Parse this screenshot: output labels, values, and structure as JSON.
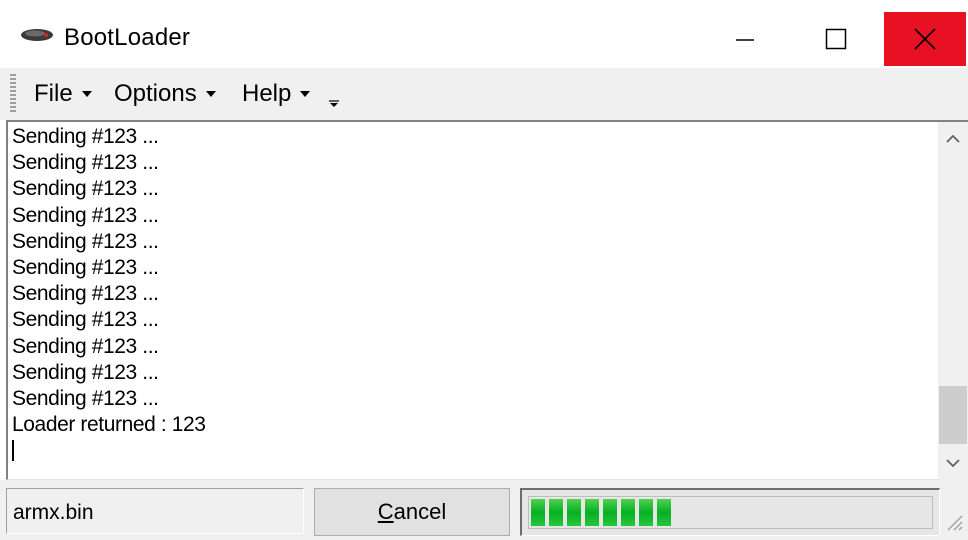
{
  "window": {
    "title": "BootLoader",
    "icons": {
      "app": "device-icon",
      "minimize": "minimize-icon",
      "maximize": "maximize-icon",
      "close": "close-icon"
    },
    "close_color": "#e81123"
  },
  "menubar": {
    "items": [
      {
        "label": "File"
      },
      {
        "label": "Options"
      },
      {
        "label": "Help"
      }
    ],
    "overflow_icon": "chevron-down-icon"
  },
  "log": {
    "lines": [
      "Sending #123 ...",
      "Sending #123 ...",
      "Sending #123 ...",
      "Sending #123 ...",
      "Sending #123 ...",
      "Sending #123 ...",
      "Sending #123 ...",
      "Sending #123 ...",
      "Sending #123 ...",
      "Sending #123 ...",
      "Sending #123 ...",
      "Loader returned : 123"
    ]
  },
  "statusbar": {
    "filename": "armx.bin",
    "cancel_label_accel": "C",
    "cancel_label_rest": "ancel",
    "progress_segments": 8,
    "progress_color": "#06b025"
  }
}
